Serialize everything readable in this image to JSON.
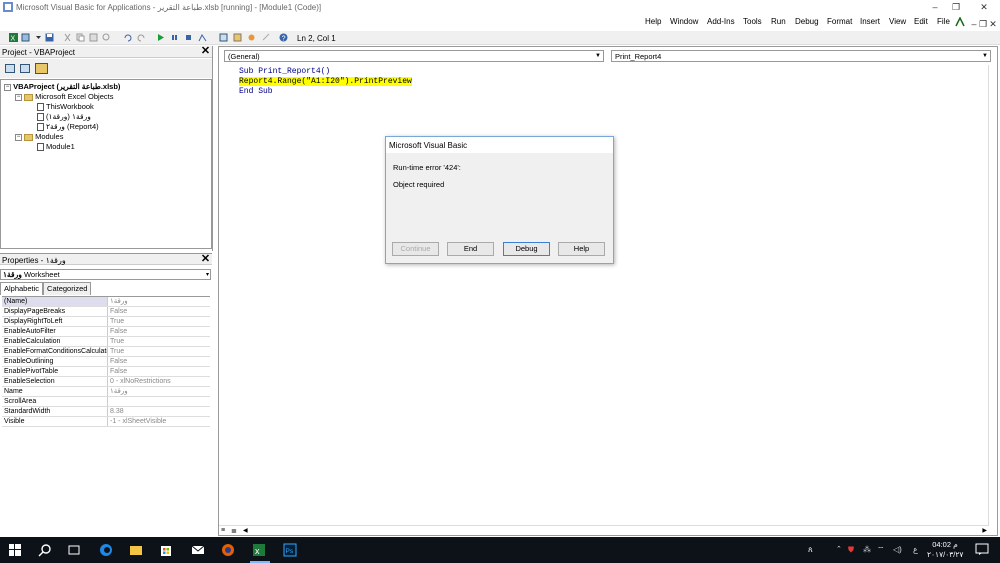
{
  "window": {
    "title": "Microsoft Visual Basic for Applications - طباعة التقرير.xlsb [running] - [Module1 (Code)]"
  },
  "menu": [
    "Help",
    "Window",
    "Add-Ins",
    "Tools",
    "Run",
    "Debug",
    "Format",
    "Insert",
    "View",
    "Edit",
    "File"
  ],
  "toolbar": {
    "position": "Ln 2, Col 1"
  },
  "project": {
    "title": "Project - VBAProject",
    "tree": [
      "VBAProject (طباعة التقرير.xlsb)",
      "Microsoft Excel Objects",
      "ThisWorkbook",
      "ورقة١ (ورقة١)",
      "ورقة٢ (Report4)",
      "Modules",
      "Module1"
    ]
  },
  "properties": {
    "title": "Properties - ورقة١",
    "selector": {
      "name": "ورقة١",
      "type": "Worksheet"
    },
    "tabs": [
      "Alphabetic",
      "Categorized"
    ],
    "rows": [
      {
        "name": "(Name)",
        "value": "ورقة١"
      },
      {
        "name": "DisplayPageBreaks",
        "value": "False"
      },
      {
        "name": "DisplayRightToLeft",
        "value": "True"
      },
      {
        "name": "EnableAutoFilter",
        "value": "False"
      },
      {
        "name": "EnableCalculation",
        "value": "True"
      },
      {
        "name": "EnableFormatConditionsCalculation",
        "value": "True"
      },
      {
        "name": "EnableOutlining",
        "value": "False"
      },
      {
        "name": "EnablePivotTable",
        "value": "False"
      },
      {
        "name": "EnableSelection",
        "value": "0 - xlNoRestrictions"
      },
      {
        "name": "Name",
        "value": "ورقة١"
      },
      {
        "name": "ScrollArea",
        "value": ""
      },
      {
        "name": "StandardWidth",
        "value": "8.38"
      },
      {
        "name": "Visible",
        "value": "-1 - xlSheetVisible"
      }
    ]
  },
  "code": {
    "object_combo": "(General)",
    "proc_combo": "Print_Report4",
    "line1": "Sub Print_Report4()",
    "line2": "Report4.Range(\"A1:I20\").PrintPreview",
    "line3": "End Sub"
  },
  "dialog": {
    "title": "Microsoft Visual Basic",
    "message1": "Run-time error '424':",
    "message2": "Object required",
    "buttons": [
      "Continue",
      "End",
      "Debug",
      "Help"
    ]
  },
  "taskbar": {
    "time": "04:02 م",
    "date": "٢٠١٧/٠٣/٢٧",
    "lang": "ع"
  },
  "colors": {
    "highlight": "#ffff00",
    "dialog_border": "#7aa7d8",
    "taskbar": "#0d1118"
  }
}
